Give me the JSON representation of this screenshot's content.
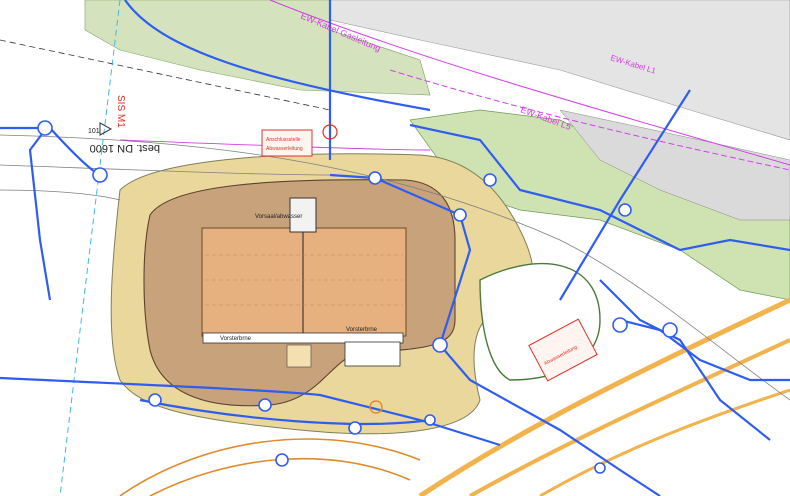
{
  "labels": {
    "kabel_1": "EW-Kabel Gasleitung",
    "kabel_2": "EW-Kabel L5",
    "kabel_3": "EW-Kabel L1",
    "pipe_label": "best. DN 1600",
    "sis_label": "SIS M1",
    "arrow_code": "101",
    "building_label": "Vorsaal/abwasser",
    "vorsterbrne_1": "Vorsterbrne",
    "vorsterbrne_2": "Vorsterbrne",
    "red_note_1": "Anschlussstelle",
    "red_note_2": "Abwasserleitung",
    "red_note_3": "Abwasserleitung"
  },
  "colors": {
    "background": "#ffffff",
    "embankment": "#e8d596",
    "basin_outer": "#c9a37a",
    "basin_inner": "#e5b07f",
    "green_zone": "#c8dcae",
    "road_grey": "#d9d9d9",
    "pipe_blue": "#2f5df0",
    "cable_magenta": "#d23ee6",
    "road_orange": "#f2b24c",
    "annotation_red": "#e0302a"
  }
}
